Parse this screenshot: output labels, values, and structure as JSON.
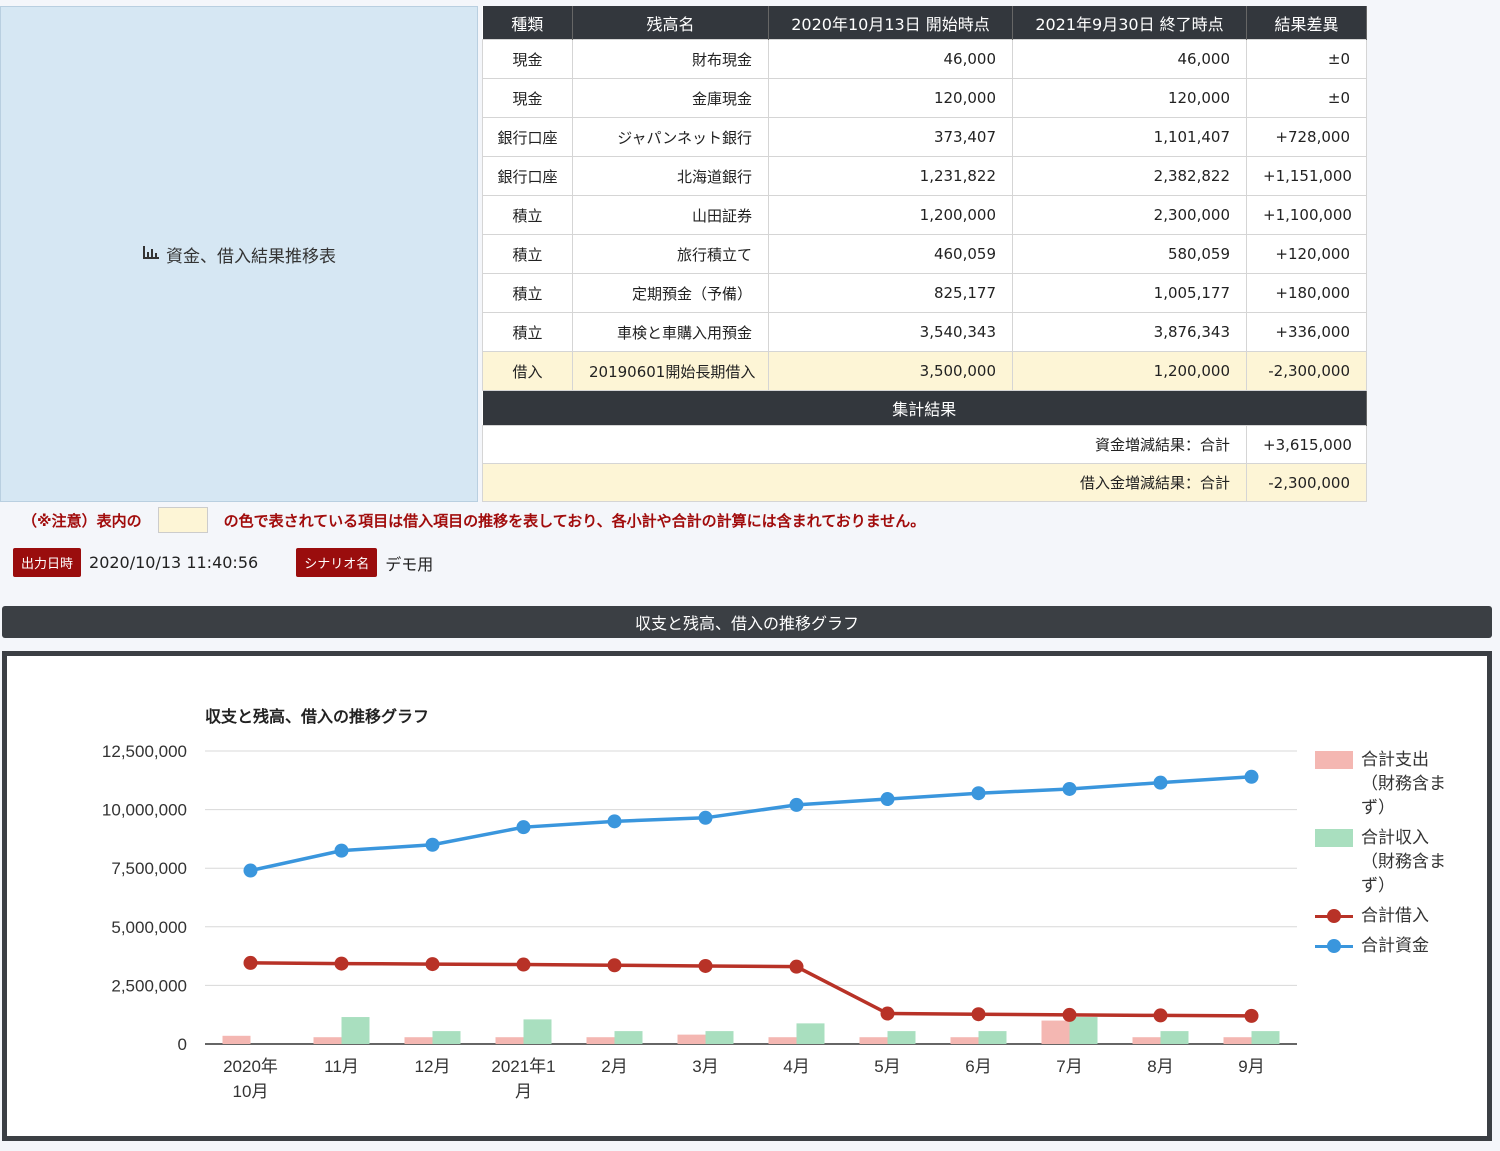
{
  "left_panel": {
    "label": "資金、借入結果推移表"
  },
  "table": {
    "headers": [
      "種類",
      "残高名",
      "2020年10月13日 開始時点",
      "2021年9月30日 終了時点",
      "結果差異"
    ],
    "rows": [
      [
        "現金",
        "財布現金",
        "46,000",
        "46,000",
        "±0"
      ],
      [
        "現金",
        "金庫現金",
        "120,000",
        "120,000",
        "±0"
      ],
      [
        "銀行口座",
        "ジャパンネット銀行",
        "373,407",
        "1,101,407",
        "+728,000"
      ],
      [
        "銀行口座",
        "北海道銀行",
        "1,231,822",
        "2,382,822",
        "+1,151,000"
      ],
      [
        "積立",
        "山田証券",
        "1,200,000",
        "2,300,000",
        "+1,100,000"
      ],
      [
        "積立",
        "旅行積立て",
        "460,059",
        "580,059",
        "+120,000"
      ],
      [
        "積立",
        "定期預金（予備）",
        "825,177",
        "1,005,177",
        "+180,000"
      ],
      [
        "積立",
        "車検と車購入用預金",
        "3,540,343",
        "3,876,343",
        "+336,000"
      ],
      [
        "借入",
        "20190601開始長期借入",
        "3,500,000",
        "1,200,000",
        "-2,300,000"
      ]
    ],
    "section_title": "集計結果",
    "totals": [
      {
        "label": "資金増減結果：合計",
        "value": "+3,615,000"
      },
      {
        "label": "借入金増減結果：合計",
        "value": "-2,300,000"
      }
    ]
  },
  "notice": {
    "prefix": "（※注意）表内の",
    "suffix": "の色で表されている項目は借入項目の推移を表しており、各小計や合計の計算には含まれておりません。",
    "loan_color": "#fdf5d6"
  },
  "meta": {
    "output_label": "出力日時",
    "output_value": "2020/10/13 11:40:56",
    "scenario_label": "シナリオ名",
    "scenario_value": "デモ用"
  },
  "graph_header": "収支と残高、借入の推移グラフ",
  "chart_data": {
    "type": "bar",
    "title": "収支と残高、借入の推移グラフ",
    "categories": [
      "2020年10月",
      "11月",
      "12月",
      "2021年1月",
      "2月",
      "3月",
      "4月",
      "5月",
      "6月",
      "7月",
      "8月",
      "9月"
    ],
    "category_lines": [
      [
        "2020年",
        "10月"
      ],
      [
        "11月"
      ],
      [
        "12月"
      ],
      [
        "2021年1",
        "月"
      ],
      [
        "2月"
      ],
      [
        "3月"
      ],
      [
        "4月"
      ],
      [
        "5月"
      ],
      [
        "6月"
      ],
      [
        "7月"
      ],
      [
        "8月"
      ],
      [
        "9月"
      ]
    ],
    "ylim": [
      0,
      12500000
    ],
    "yticks": [
      0,
      2500000,
      5000000,
      7500000,
      10000000,
      12500000
    ],
    "ytick_labels": [
      "0",
      "2,500,000",
      "5,000,000",
      "7,500,000",
      "10,000,000",
      "12,500,000"
    ],
    "series": [
      {
        "name": "合計支出（財務含まず）",
        "kind": "bar",
        "color": "#f4b7b2",
        "values": [
          350000,
          290000,
          290000,
          290000,
          290000,
          400000,
          290000,
          290000,
          290000,
          1000000,
          290000,
          290000
        ]
      },
      {
        "name": "合計収入（財務含まず）",
        "kind": "bar",
        "color": "#a9dfbf",
        "values": [
          0,
          1150000,
          550000,
          1050000,
          550000,
          550000,
          880000,
          550000,
          550000,
          1150000,
          550000,
          550000
        ]
      },
      {
        "name": "合計借入",
        "kind": "line",
        "color": "#b83227",
        "values": [
          3460000,
          3430000,
          3410000,
          3390000,
          3360000,
          3330000,
          3300000,
          1300000,
          1270000,
          1240000,
          1220000,
          1200000
        ]
      },
      {
        "name": "合計資金",
        "kind": "line",
        "color": "#3a96dd",
        "values": [
          7400000,
          8250000,
          8500000,
          9250000,
          9500000,
          9650000,
          10200000,
          10450000,
          10700000,
          10880000,
          11150000,
          11400000
        ]
      }
    ],
    "legend_lines": [
      [
        "合計支出",
        "（財務含ま",
        "ず）"
      ],
      [
        "合計収入",
        "（財務含ま",
        "ず）"
      ],
      [
        "合計借入"
      ],
      [
        "合計資金"
      ]
    ],
    "legend_position": "right",
    "grid": true
  }
}
